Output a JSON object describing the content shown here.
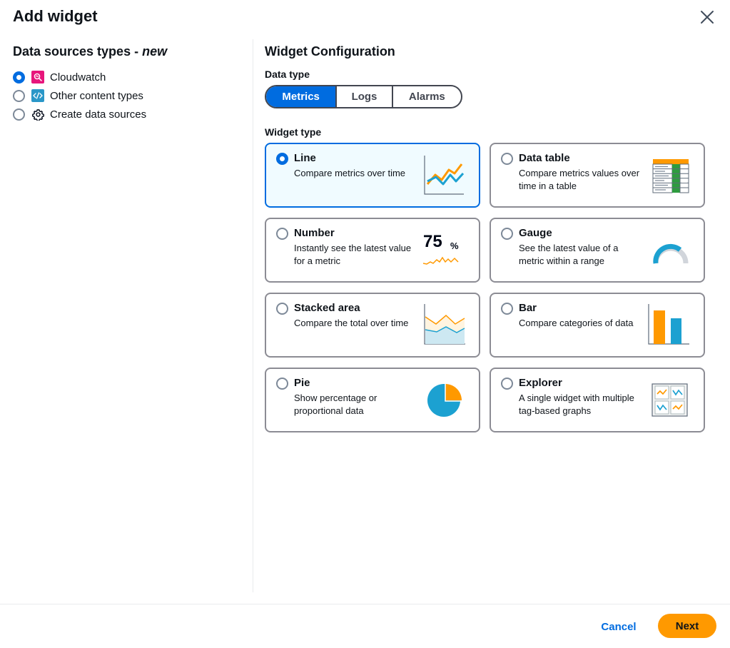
{
  "modal": {
    "title": "Add widget",
    "close_icon": "close-icon"
  },
  "sources": {
    "heading_prefix": "Data sources types - ",
    "heading_emph": "new",
    "items": [
      {
        "label": "Cloudwatch",
        "checked": true,
        "icon": "cloudwatch-icon",
        "icon_color": "#e7157b"
      },
      {
        "label": "Other content types",
        "checked": false,
        "icon": "code-icon",
        "icon_color": "#2a97c8"
      },
      {
        "label": "Create data sources",
        "checked": false,
        "icon": "gear-icon",
        "icon_color": "#000716"
      }
    ]
  },
  "config": {
    "heading": "Widget Configuration",
    "data_type_label": "Data type",
    "data_types": [
      "Metrics",
      "Logs",
      "Alarms"
    ],
    "data_type_selected": "Metrics",
    "widget_type_label": "Widget type",
    "widgets": [
      {
        "title": "Line",
        "desc": "Compare metrics over time",
        "selected": true,
        "icon": "line-chart-icon"
      },
      {
        "title": "Data table",
        "desc": "Compare metrics values over time in a table",
        "selected": false,
        "icon": "table-icon"
      },
      {
        "title": "Number",
        "desc": "Instantly see the latest value for a metric",
        "selected": false,
        "icon": "number-icon",
        "illus_value": "75",
        "illus_unit": "%"
      },
      {
        "title": "Gauge",
        "desc": "See the latest value of a metric within a range",
        "selected": false,
        "icon": "gauge-icon"
      },
      {
        "title": "Stacked area",
        "desc": "Compare the total over time",
        "selected": false,
        "icon": "stacked-area-icon"
      },
      {
        "title": "Bar",
        "desc": "Compare categories of data",
        "selected": false,
        "icon": "bar-chart-icon"
      },
      {
        "title": "Pie",
        "desc": "Show percentage or proportional data",
        "selected": false,
        "icon": "pie-chart-icon"
      },
      {
        "title": "Explorer",
        "desc": "A single widget with multiple tag-based graphs",
        "selected": false,
        "icon": "explorer-icon"
      }
    ]
  },
  "footer": {
    "cancel_label": "Cancel",
    "next_label": "Next"
  },
  "colors": {
    "accent": "#006ce0",
    "primary_button": "#ff9900",
    "illus_orange": "#ff9900",
    "illus_blue": "#1ca1d1",
    "illus_green": "#2e9c3f"
  }
}
